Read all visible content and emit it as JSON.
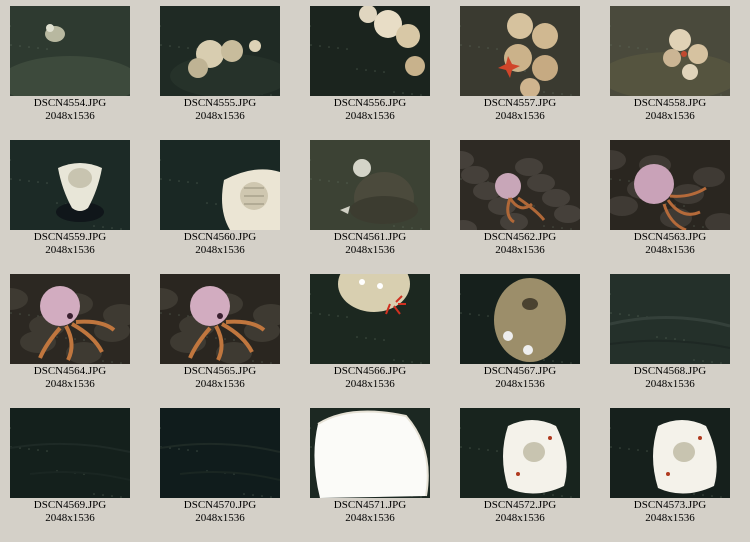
{
  "gallery": {
    "items": [
      {
        "filename": "DSCN4554.JPG",
        "dimensions": "2048x1536",
        "icon": "seafloor-small-anemone-photo",
        "bg": "#2e3a30"
      },
      {
        "filename": "DSCN4555.JPG",
        "dimensions": "2048x1536",
        "icon": "anemone-cluster-photo",
        "bg": "#1f2a24"
      },
      {
        "filename": "DSCN4556.JPG",
        "dimensions": "2048x1536",
        "icon": "anemone-rock-photo",
        "bg": "#1b241e"
      },
      {
        "filename": "DSCN4557.JPG",
        "dimensions": "2048x1536",
        "icon": "anemones-sea-star-photo",
        "bg": "#3a3a30"
      },
      {
        "filename": "DSCN4558.JPG",
        "dimensions": "2048x1536",
        "icon": "anemone-group-photo",
        "bg": "#4a4a3c"
      },
      {
        "filename": "DSCN4559.JPG",
        "dimensions": "2048x1536",
        "icon": "glass-sponge-photo",
        "bg": "#1c2a26"
      },
      {
        "filename": "DSCN4560.JPG",
        "dimensions": "2048x1536",
        "icon": "glass-sponge-closeup-photo",
        "bg": "#1a2824"
      },
      {
        "filename": "DSCN4561.JPG",
        "dimensions": "2048x1536",
        "icon": "rock-mound-photo",
        "bg": "#3c4234"
      },
      {
        "filename": "DSCN4562.JPG",
        "dimensions": "2048x1536",
        "icon": "octopus-rocks-photo",
        "bg": "#2e2a24"
      },
      {
        "filename": "DSCN4563.JPG",
        "dimensions": "2048x1536",
        "icon": "octopus-photo",
        "bg": "#2a2620"
      },
      {
        "filename": "DSCN4564.JPG",
        "dimensions": "2048x1536",
        "icon": "octopus-closeup-photo",
        "bg": "#2c2822"
      },
      {
        "filename": "DSCN4565.JPG",
        "dimensions": "2048x1536",
        "icon": "octopus-closeup-photo",
        "bg": "#2a2620"
      },
      {
        "filename": "DSCN4566.JPG",
        "dimensions": "2048x1536",
        "icon": "sponge-crab-photo",
        "bg": "#1c2820"
      },
      {
        "filename": "DSCN4567.JPG",
        "dimensions": "2048x1536",
        "icon": "large-sponge-photo",
        "bg": "#16201c"
      },
      {
        "filename": "DSCN4568.JPG",
        "dimensions": "2048x1536",
        "icon": "bare-seafloor-photo",
        "bg": "#24302a"
      },
      {
        "filename": "DSCN4569.JPG",
        "dimensions": "2048x1536",
        "icon": "dark-seafloor-photo",
        "bg": "#14201c"
      },
      {
        "filename": "DSCN4570.JPG",
        "dimensions": "2048x1536",
        "icon": "dark-seafloor-photo",
        "bg": "#101c1c"
      },
      {
        "filename": "DSCN4571.JPG",
        "dimensions": "2048x1536",
        "icon": "overexposed-sponge-photo",
        "bg": "#1c2822"
      },
      {
        "filename": "DSCN4572.JPG",
        "dimensions": "2048x1536",
        "icon": "white-sponge-photo",
        "bg": "#18241e"
      },
      {
        "filename": "DSCN4573.JPG",
        "dimensions": "2048x1536",
        "icon": "white-sponge-photo",
        "bg": "#16201c"
      }
    ]
  }
}
